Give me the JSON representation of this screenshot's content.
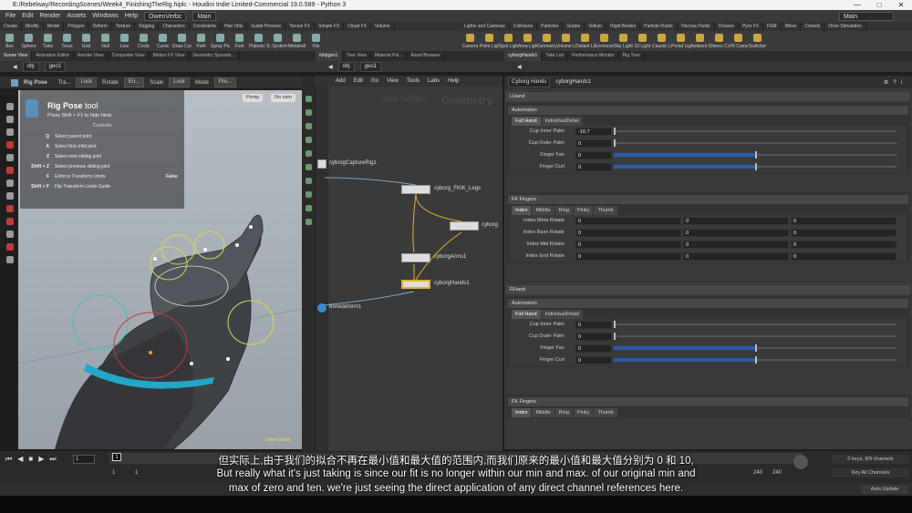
{
  "window": {
    "title": "E:/Rebelway/RecordingScenes/Week4_FinishingTheRig.hiplc - Houdini Indie Limited-Commercial 19.0.589 - Python 3"
  },
  "menu": {
    "items": [
      "File",
      "Edit",
      "Render",
      "Assets",
      "Windows",
      "Help"
    ],
    "desktop": "OwenVerbc",
    "main_label": "Main",
    "right_main": "Main"
  },
  "shelf": {
    "tabs_left": [
      "Create",
      "Modify",
      "Model",
      "Polygon",
      "Deform",
      "Texture",
      "Rigging",
      "Characters",
      "Constraints",
      "Hair Utils",
      "Guide Process",
      "Terrain FX",
      "Simple FX",
      "Cloud FX",
      "Volume"
    ],
    "tabs_right": [
      "Lights and Cameras",
      "Collisions",
      "Particles",
      "Grains",
      "Vellum",
      "Rigid Bodies",
      "Particle Fluids",
      "Viscous Fluids",
      "Oceans",
      "Pyro FX",
      "FEM",
      "Wires",
      "Crowds",
      "Drive Simulation"
    ],
    "tools_left": [
      "Box",
      "Sphere",
      "Tube",
      "Torus",
      "Grid",
      "Null",
      "Line",
      "Circle",
      "Curve",
      "Draw Curve",
      "Path",
      "Spray Paint",
      "Font",
      "Platonic Solids",
      "L-System",
      "Metaball",
      "File"
    ],
    "tools_right": [
      "Camera",
      "Point Light",
      "Spot Light",
      "Area Light",
      "Geometry Light",
      "Volume Light",
      "Distant Light",
      "Environment Light",
      "Sky Light",
      "GI Light",
      "Caustic Light",
      "Portal Light",
      "Ambient Light",
      "Stereo Camera",
      "VR Camera",
      "Switcher"
    ]
  },
  "left_panel": {
    "tabs": [
      "Scene View",
      "Animation Editor",
      "Render View",
      "Composite View",
      "Motion FX View",
      "Geometry Spreads..."
    ],
    "path": [
      "obj",
      "geo1"
    ],
    "toolbar": {
      "mode": "Rig Pose",
      "tra": "Tra...",
      "lock1": "Lock",
      "rotate": "Rotate",
      "en": "En...",
      "scale": "Scale",
      "lock2": "Lock",
      "mode_label": "Mode",
      "pre": "Pre..."
    },
    "view_persp": "Persp",
    "view_cam": "No cam",
    "hud": {
      "title": "Rig Pose",
      "title_suffix": "tool",
      "hint": "Press Shift + F1 to hide hints",
      "controls_heading": "Controls",
      "controls": [
        {
          "key": "Q",
          "desc": "Select parent joint"
        },
        {
          "key": "A",
          "desc": "Select first child joint"
        },
        {
          "key": "Z",
          "desc": "Select next sibling joint"
        },
        {
          "key": "Shift + Z",
          "desc": "Select previous sibling joint"
        },
        {
          "key": "F",
          "desc": "Enforce Transform Limits",
          "value": "False"
        },
        {
          "key": "Shift + F",
          "desc": "Flip Transform Limits Guide"
        }
      ]
    },
    "watermark": "Indie Edition"
  },
  "network": {
    "tabs": [
      "/obj/geo1",
      "Tree View",
      "Material Pal...",
      "Asset Browser"
    ],
    "path": [
      "obj",
      "geo1"
    ],
    "menu": [
      "Add",
      "Edit",
      "Go",
      "View",
      "Tools",
      "Labs",
      "Help"
    ],
    "watermark_left": "Indie Edition",
    "watermark_right": "Geometry",
    "nodes": [
      {
        "name": "cyborgCaptureRig1"
      },
      {
        "name": "cyborg_FKIK_Legs"
      },
      {
        "name": "cyborg"
      },
      {
        "name": "cyborgArms1"
      },
      {
        "name": "cyborgHands1"
      },
      {
        "name": "bonedeform1"
      }
    ]
  },
  "params": {
    "tabs": [
      "cyborgHands1",
      "Take List",
      "Performance Monitor",
      "Rig Tree"
    ],
    "node_label": "Cyborg Hands",
    "node_name": "cyborgHands1",
    "lhand": {
      "heading": "LHand",
      "automation": "Automation",
      "tabs": [
        "Full Hand",
        "IndividualDetail"
      ],
      "rows": [
        {
          "label": "Cup Inner Palm",
          "value": "-10.7",
          "fill": 0
        },
        {
          "label": "Cup Outer Palm",
          "value": "0",
          "fill": 0
        },
        {
          "label": "Finger Fan",
          "value": "0",
          "fill": 0.5
        },
        {
          "label": "Finger Curl",
          "value": "0",
          "fill": 0.5
        }
      ],
      "fk_heading": "FK Fingers",
      "fk_tabs": [
        "Index",
        "Middle",
        "Ring",
        "Pinky",
        "Thumb"
      ],
      "fk_rows": [
        {
          "label": "Index Meta Rotate",
          "values": [
            "0",
            "0",
            "0"
          ]
        },
        {
          "label": "Index Base Rotate",
          "values": [
            "0",
            "0",
            "0"
          ]
        },
        {
          "label": "Index Mid Rotate",
          "values": [
            "0",
            "0",
            "0"
          ]
        },
        {
          "label": "Index End Rotate",
          "values": [
            "0",
            "0",
            "0"
          ]
        }
      ]
    },
    "rhand": {
      "heading": "RHand",
      "automation": "Automation",
      "tabs": [
        "Full Hand",
        "IndividualDetail"
      ],
      "rows": [
        {
          "label": "Cup Inner Palm",
          "value": "0",
          "fill": 0
        },
        {
          "label": "Cup Outer Palm",
          "value": "0",
          "fill": 0
        },
        {
          "label": "Finger Fan",
          "value": "0",
          "fill": 0.5
        },
        {
          "label": "Finger Curl",
          "value": "0",
          "fill": 0.5
        }
      ],
      "fk_heading": "FK Fingers",
      "fk_tabs": [
        "Index",
        "Middle",
        "Ring",
        "Pinky",
        "Thumb"
      ]
    }
  },
  "timeline": {
    "frame": "1",
    "marker": "1",
    "start": "1",
    "start2": "1",
    "end1": "240",
    "end2": "240",
    "keys_info": "0 keys, 9/9 channels",
    "key_all": "Key All Channels",
    "auto_update": "Auto Update"
  },
  "subtitles": {
    "zh": "但实际上,由于我们的拟合不再在最小值和最大值的范围内,而我们原来的最小值和最大值分别为 0 和 10,",
    "en1": "But really what it's just taking is since our fit is no longer within our min and max. of our original min and",
    "en2": "max of zero and ten. we're just seeing the direct application of any direct channel references here."
  }
}
